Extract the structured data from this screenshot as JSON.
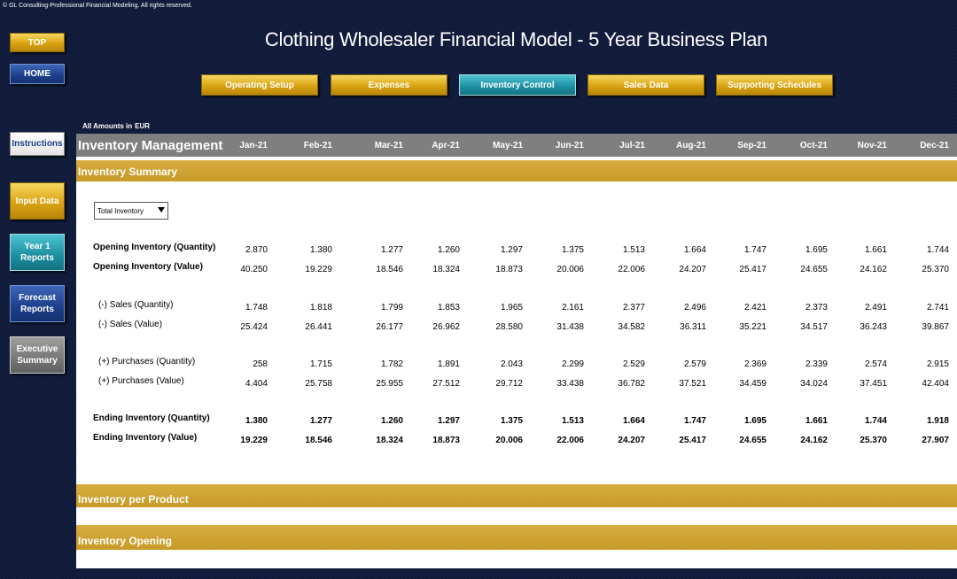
{
  "copyright": "© GL Consulting-Professional Financial Modeling. All rights reserved.",
  "title": "Clothing Wholesaler Financial Model - 5 Year Business Plan",
  "side_nav": {
    "top": "TOP",
    "home": "HOME",
    "instructions": "Instructions",
    "input_data": "Input Data",
    "year1_reports": "Year 1 Reports",
    "forecast_reports": "Forecast Reports",
    "executive_summary": "Executive Summary"
  },
  "top_nav": {
    "operating_setup": "Operating Setup",
    "expenses": "Expenses",
    "inventory_control": "Inventory Control",
    "sales_data": "Sales Data",
    "supporting_schedules": "Supporting Schedules"
  },
  "amounts_label": "All Amounts in",
  "currency": "EUR",
  "sheet": {
    "header_title": "Inventory Management",
    "months": [
      "Jan-21",
      "Feb-21",
      "Mar-21",
      "Apr-21",
      "May-21",
      "Jun-21",
      "Jul-21",
      "Aug-21",
      "Sep-21",
      "Oct-21",
      "Nov-21",
      "Dec-21"
    ],
    "section_summary": "Inventory Summary",
    "section_per_product": "Inventory per Product",
    "section_opening": "Inventory Opening",
    "dropdown_value": "Total Inventory",
    "rows": [
      {
        "label": "Opening Inventory (Quantity)",
        "bold": true,
        "values": [
          "2.870",
          "1.380",
          "1.277",
          "1.260",
          "1.297",
          "1.375",
          "1.513",
          "1.664",
          "1.747",
          "1.695",
          "1.661",
          "1.744"
        ]
      },
      {
        "label": "Opening Inventory (Value)",
        "bold": true,
        "values": [
          "40.250",
          "19.229",
          "18.546",
          "18.324",
          "18.873",
          "20.006",
          "22.006",
          "24.207",
          "25.417",
          "24.655",
          "24.162",
          "25.370"
        ]
      },
      {
        "label": "(-) Sales (Quantity)",
        "bold": false,
        "values": [
          "1.748",
          "1.818",
          "1.799",
          "1.853",
          "1.965",
          "2.161",
          "2.377",
          "2.496",
          "2.421",
          "2.373",
          "2.491",
          "2.741"
        ]
      },
      {
        "label": "(-) Sales (Value)",
        "bold": false,
        "values": [
          "25.424",
          "26.441",
          "26.177",
          "26.962",
          "28.580",
          "31.438",
          "34.582",
          "36.311",
          "35.221",
          "34.517",
          "36.243",
          "39.867"
        ]
      },
      {
        "label": "(+) Purchases (Quantity)",
        "bold": false,
        "values": [
          "258",
          "1.715",
          "1.782",
          "1.891",
          "2.043",
          "2.299",
          "2.529",
          "2.579",
          "2.369",
          "2.339",
          "2.574",
          "2.915"
        ]
      },
      {
        "label": "(+) Purchases (Value)",
        "bold": false,
        "values": [
          "4.404",
          "25.758",
          "25.955",
          "27.512",
          "29.712",
          "33.438",
          "36.782",
          "37.521",
          "34.459",
          "34.024",
          "37.451",
          "42.404"
        ]
      },
      {
        "label": "Ending Inventory (Quantity)",
        "bold": true,
        "values": [
          "1.380",
          "1.277",
          "1.260",
          "1.297",
          "1.375",
          "1.513",
          "1.664",
          "1.747",
          "1.695",
          "1.661",
          "1.744",
          "1.918"
        ]
      },
      {
        "label": "Ending Inventory (Value)",
        "bold": true,
        "values": [
          "19.229",
          "18.546",
          "18.324",
          "18.873",
          "20.006",
          "22.006",
          "24.207",
          "25.417",
          "24.655",
          "24.162",
          "25.370",
          "27.907"
        ]
      }
    ]
  }
}
